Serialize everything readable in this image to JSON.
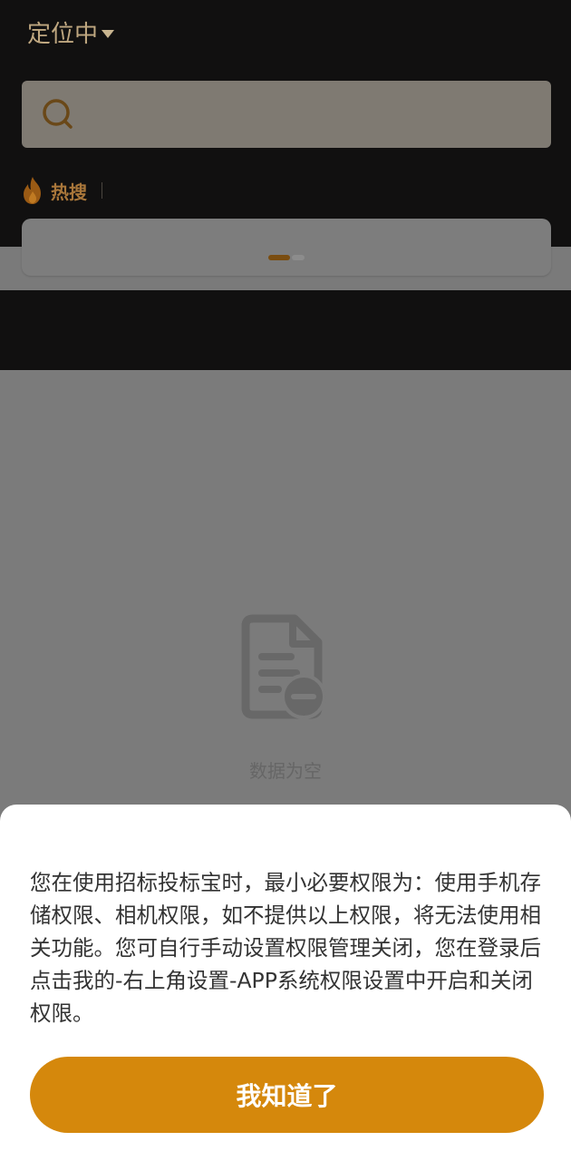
{
  "header": {
    "location_label": "定位中",
    "hot_search_label": "热搜"
  },
  "empty_state": {
    "text": "数据为空"
  },
  "permission_sheet": {
    "message": "您在使用招标投标宝时，最小必要权限为：使用手机存储权限、相机权限，如不提供以上权限，将无法使用相关功能。您可自行手动设置权限管理关闭，您在登录后点击我的-右上角设置-APP系统权限设置中开启和关闭权限。",
    "confirm_label": "我知道了"
  },
  "colors": {
    "accent": "#d5880c",
    "header_bg": "#111010",
    "overlay_bg": "#7b7b7b"
  },
  "icons": {
    "search": "search-icon",
    "flame": "flame-icon",
    "empty": "empty-document-icon",
    "caret": "caret-down-icon"
  },
  "banner": {
    "active_indicator": 1,
    "indicator_count": 2
  }
}
